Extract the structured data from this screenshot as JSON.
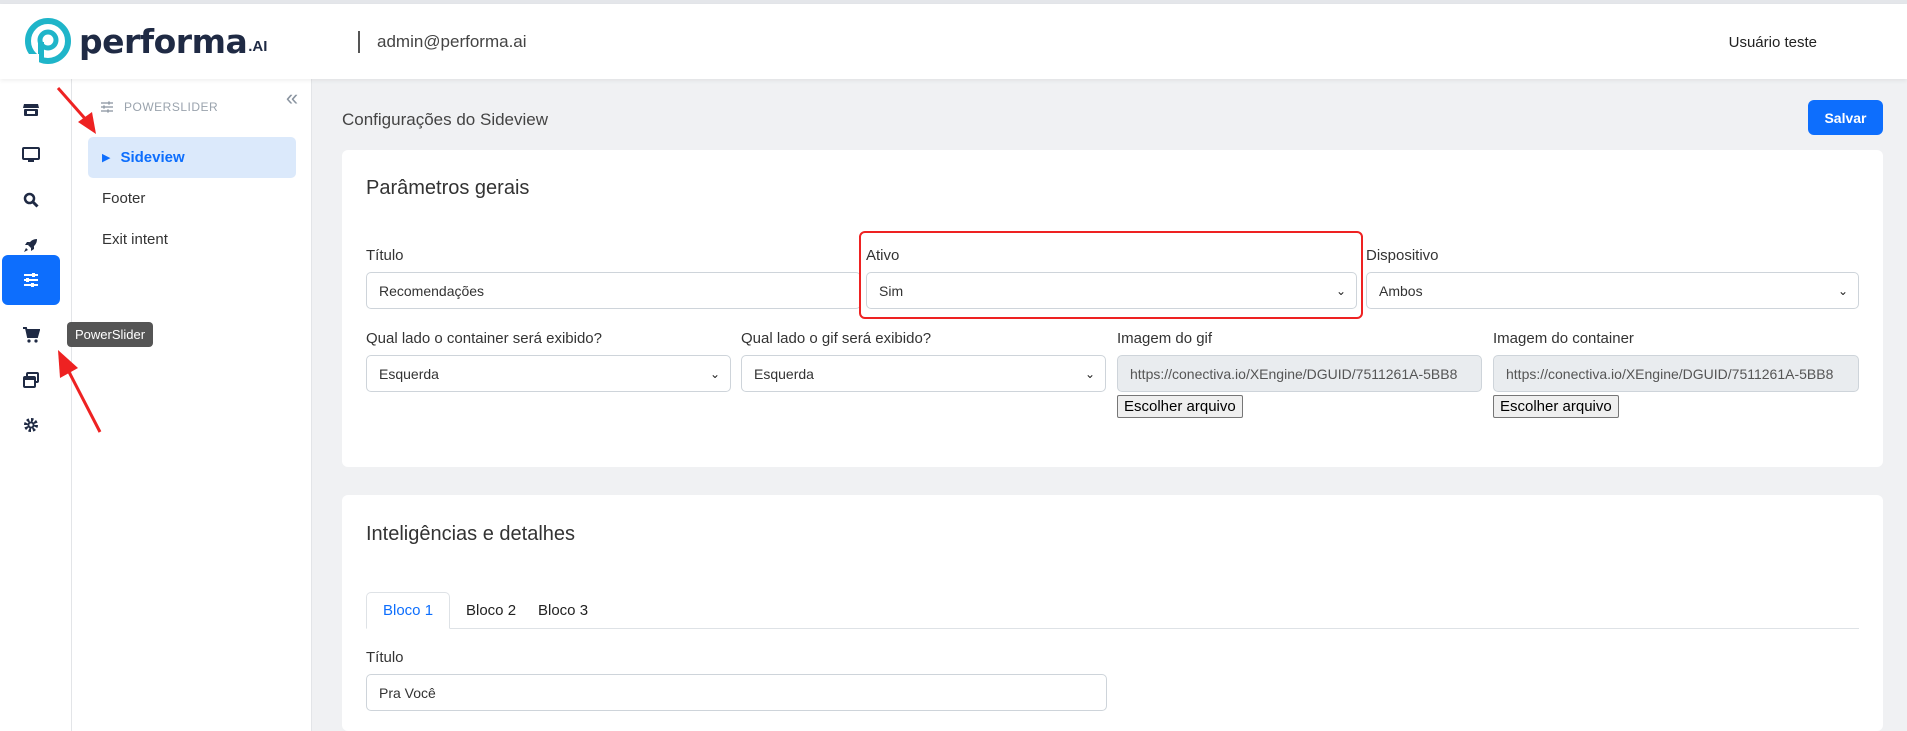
{
  "header": {
    "logo_text": "performa",
    "logo_suffix": ".AI",
    "email": "admin@performa.ai",
    "user": "Usuário teste"
  },
  "rail": {
    "items": [
      "store-icon",
      "monitor-icon",
      "search-icon",
      "rocket-icon",
      "sliders-icon",
      "cart-icon",
      "windows-icon",
      "gear-icon"
    ],
    "active": "sliders-icon",
    "tooltip": "PowerSlider"
  },
  "subnav": {
    "heading": "POWERSLIDER",
    "items": [
      {
        "label": "Sideview",
        "active": true
      },
      {
        "label": "Footer",
        "active": false
      },
      {
        "label": "Exit intent",
        "active": false
      }
    ]
  },
  "main": {
    "page_title": "Configurações do Sideview",
    "save_label": "Salvar"
  },
  "general": {
    "title": "Parâmetros gerais",
    "titulo": {
      "label": "Título",
      "value": "Recomendações"
    },
    "ativo": {
      "label": "Ativo",
      "value": "Sim"
    },
    "dispositivo": {
      "label": "Dispositivo",
      "value": "Ambos"
    },
    "lado_container": {
      "label": "Qual lado o container será exibido?",
      "value": "Esquerda"
    },
    "lado_gif": {
      "label": "Qual lado o gif será exibido?",
      "value": "Esquerda"
    },
    "imagem_gif": {
      "label": "Imagem do gif",
      "value": "https://conectiva.io/XEngine/DGUID/7511261A-5BB8",
      "button": "Escolher arquivo"
    },
    "imagem_container": {
      "label": "Imagem do container",
      "value": "https://conectiva.io/XEngine/DGUID/7511261A-5BB8",
      "button": "Escolher arquivo"
    }
  },
  "intelligence": {
    "title": "Inteligências e detalhes",
    "tabs": [
      {
        "label": "Bloco 1",
        "active": true
      },
      {
        "label": "Bloco 2",
        "active": false
      },
      {
        "label": "Bloco 3",
        "active": false
      }
    ],
    "titulo": {
      "label": "Título",
      "value": "Pra Você"
    }
  },
  "colors": {
    "accent": "#0d6efd",
    "highlight": "#ee2222",
    "logo_teal": "#1fb5c9"
  }
}
